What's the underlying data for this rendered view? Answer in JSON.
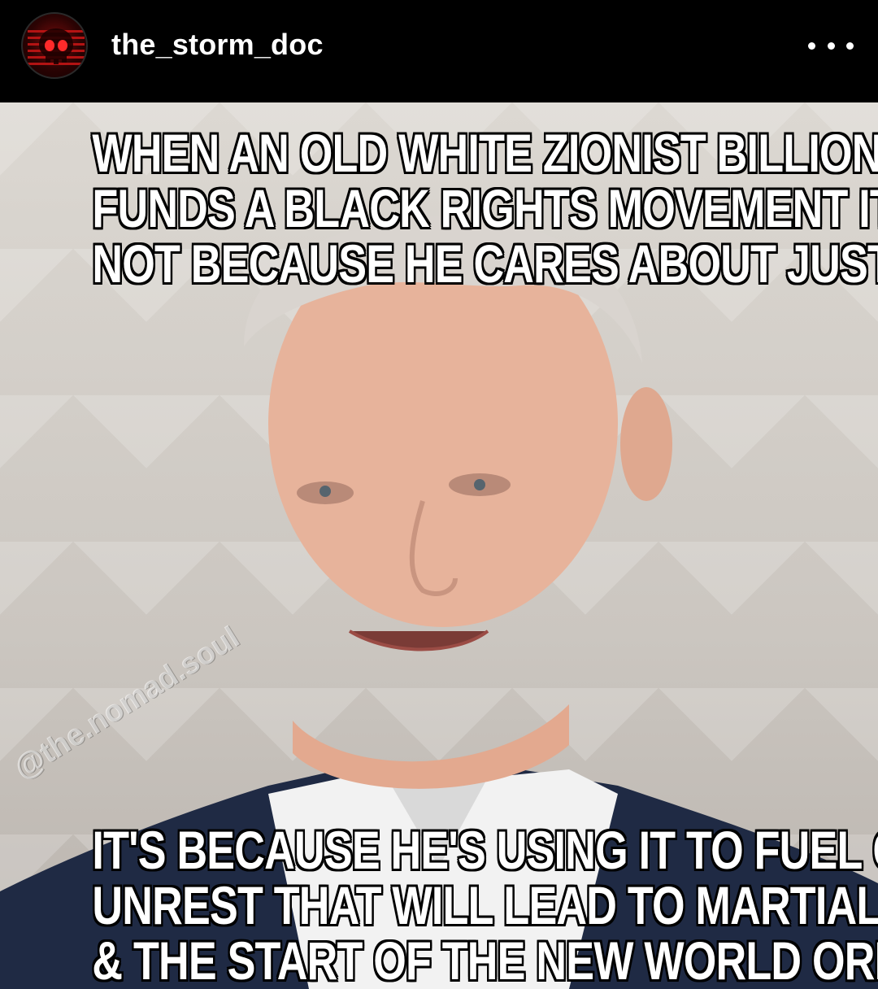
{
  "header": {
    "username": "the_storm_doc",
    "avatar_icon": "skull-flag-icon",
    "more_icon": "more-options-icon"
  },
  "post": {
    "top_caption": [
      "WHEN AN OLD WHITE ZIONIST BILLIONAIRE",
      "FUNDS A BLACK RIGHTS MOVEMENT IT'S",
      "NOT BECAUSE HE CARES ABOUT JUSTICE"
    ],
    "bottom_caption": [
      "IT'S BECAUSE HE'S USING IT TO FUEL CIVIL",
      "UNREST THAT WILL LEAD TO MARTIAL LAW",
      "& THE START OF THE NEW WORLD ORDER"
    ],
    "watermark": "@the.nomad.soul"
  },
  "colors": {
    "header_bg": "#000000",
    "username": "#ffffff",
    "caption_fill": "#ffffff",
    "caption_outline": "#000000",
    "suit": "#1f2a44",
    "shirt": "#f2f2f2",
    "skin": "#e9b8a0",
    "avatar_red": "#8b0e0e"
  }
}
